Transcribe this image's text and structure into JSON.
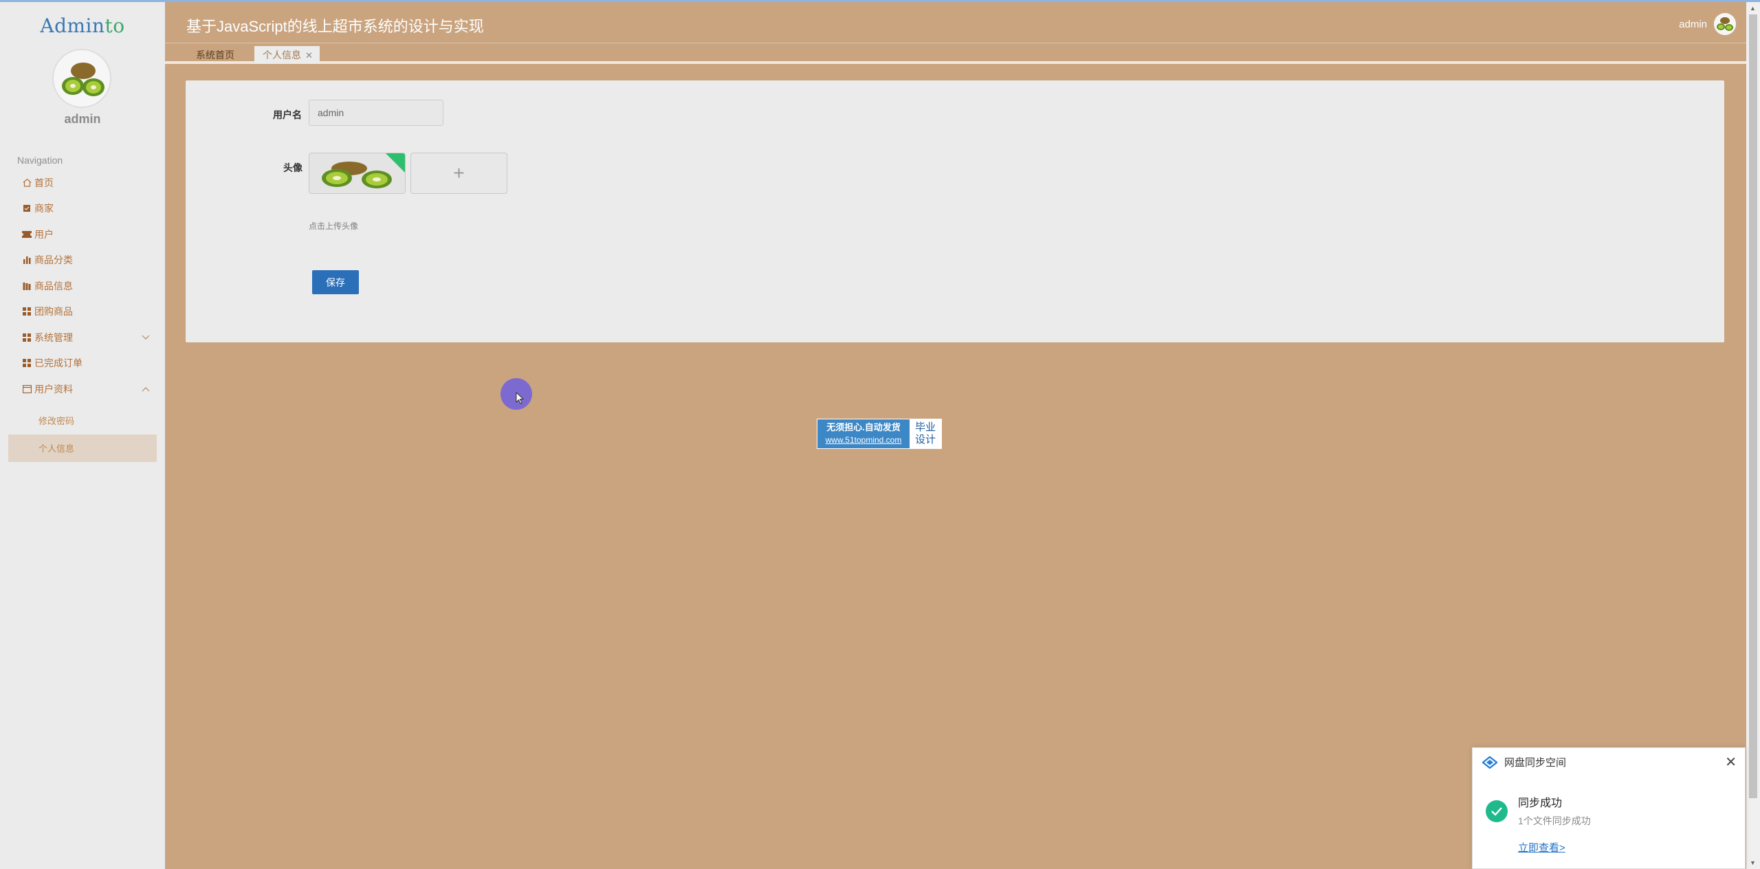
{
  "sidebar": {
    "logo_main": "Admin",
    "logo_accent": "to",
    "username": "admin",
    "nav_title": "Navigation",
    "items": [
      {
        "label": "首页",
        "icon": "home-icon"
      },
      {
        "label": "商家",
        "icon": "store-icon"
      },
      {
        "label": "用户",
        "icon": "ticket-icon"
      },
      {
        "label": "商品分类",
        "icon": "bar-chart-icon"
      },
      {
        "label": "商品信息",
        "icon": "books-icon"
      },
      {
        "label": "团购商品",
        "icon": "grid-icon"
      },
      {
        "label": "系统管理",
        "icon": "grid-icon"
      },
      {
        "label": "已完成订单",
        "icon": "grid-icon"
      },
      {
        "label": "用户资料",
        "icon": "profile-card-icon"
      }
    ],
    "sub_items": [
      {
        "label": "修改密码"
      },
      {
        "label": "个人信息"
      }
    ]
  },
  "header": {
    "title": "基于JavaScript的线上超市系统的设计与实现",
    "username": "admin"
  },
  "tabs": [
    {
      "label": "系统首页"
    },
    {
      "label": "个人信息"
    }
  ],
  "form": {
    "username_label": "用户名",
    "username_value": "admin",
    "avatar_label": "头像",
    "upload_plus": "+",
    "upload_hint": "点击上传头像",
    "save_label": "保存"
  },
  "watermark": {
    "line1": "无须担心.自动发货",
    "line2": "www.51topmind.com",
    "right1": "毕业",
    "right2": "设计"
  },
  "notification": {
    "app_name": "网盘同步空间",
    "title": "同步成功",
    "subtitle": "1个文件同步成功",
    "link": "立即查看>"
  },
  "colors": {
    "accent": "#c9a47f",
    "sidebar_bg": "#ebebeb",
    "primary_button": "#2a6fb7",
    "success": "#1fba8c"
  }
}
